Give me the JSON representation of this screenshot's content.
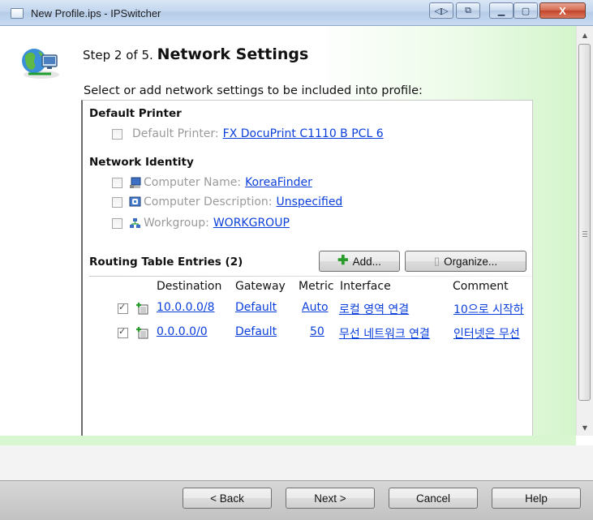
{
  "window": {
    "title": "New Profile.ips - IPSwitcher",
    "close_glyph": "X"
  },
  "header": {
    "step_prefix": "Step 2 of 5.",
    "step_title": "Network Settings",
    "subtitle": "Select or add network settings to be included into profile:"
  },
  "sections": {
    "default_printer": {
      "heading": "Default Printer",
      "label": "Default Printer:",
      "value": "FX DocuPrint C1110 B PCL 6",
      "checked": false
    },
    "network_identity": {
      "heading": "Network Identity",
      "items": [
        {
          "label": "Computer Name:",
          "value": "KoreaFinder",
          "icon": "computer-icon",
          "checked": false
        },
        {
          "label": "Computer Description:",
          "value": "Unspecified",
          "icon": "description-icon",
          "checked": false
        },
        {
          "label": "Workgroup:",
          "value": "WORKGROUP",
          "icon": "workgroup-icon",
          "checked": false
        }
      ]
    },
    "routing": {
      "heading": "Routing Table Entries (2)",
      "add_label": "Add...",
      "organize_label": "Organize...",
      "columns": {
        "destination": "Destination",
        "gateway": "Gateway",
        "metric": "Metric",
        "interface": "Interface",
        "comment": "Comment"
      },
      "rows": [
        {
          "checked": true,
          "destination": "10.0.0.0/8",
          "gateway": "Default",
          "metric": "Auto",
          "interface": "로컬 영역 연결",
          "comment": "10으로 시작하"
        },
        {
          "checked": true,
          "destination": "0.0.0.0/0",
          "gateway": "Default",
          "metric": "50",
          "interface": "무선 네트워크 연결",
          "comment": "인터넷은 무선"
        }
      ]
    }
  },
  "footer": {
    "back_label": "< Back",
    "next_label": "Next >",
    "cancel_label": "Cancel",
    "help_label": "Help"
  },
  "colors": {
    "link": "#0a3fdc",
    "disabled_text": "#9a9a9a",
    "green_accent": "#d4f5cc"
  }
}
